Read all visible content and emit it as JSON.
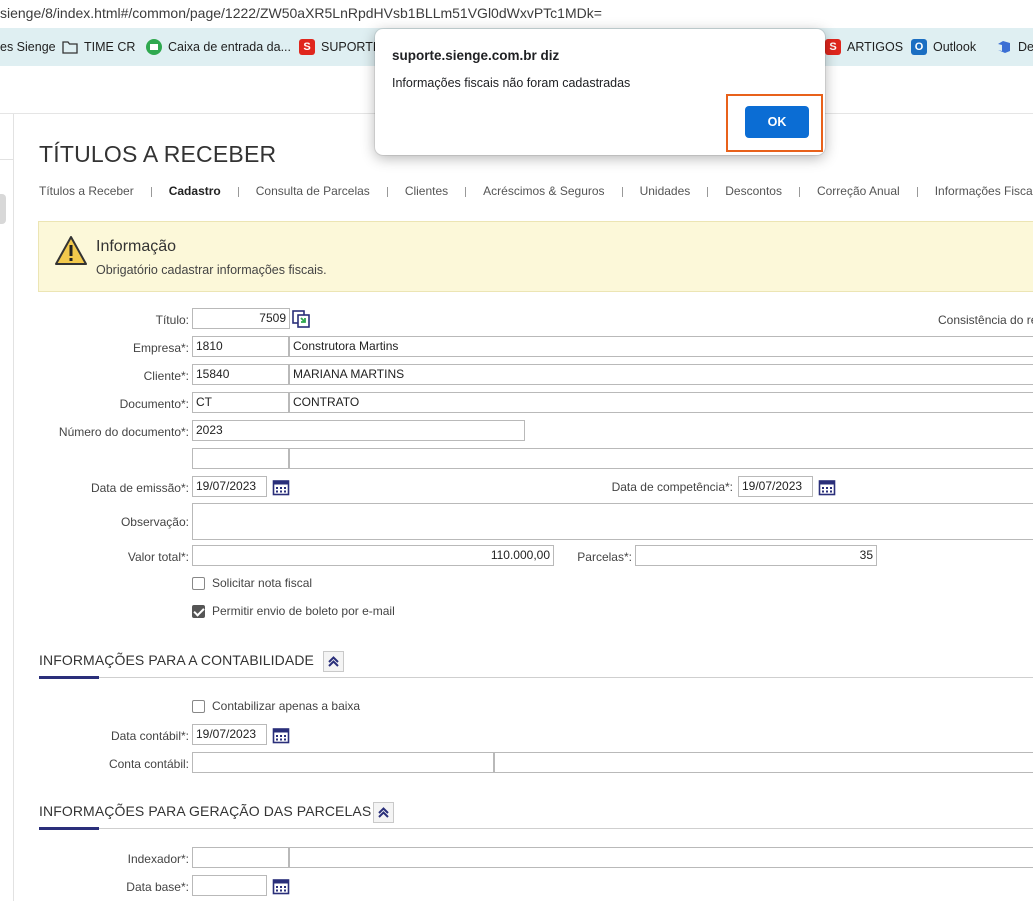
{
  "browser": {
    "url": "sienge/8/index.html#/common/page/1222/ZW50aXR5LnRpdHVsb1BLLm51VGl0dWxvPTc1MDk=",
    "bookmarks": [
      {
        "label": "es Sienge",
        "icon": "folder-icon"
      },
      {
        "label": "TIME CR",
        "icon": "folder-icon"
      },
      {
        "label": "Caixa de entrada da...",
        "icon": "mail-icon",
        "color": "#2fa84f"
      },
      {
        "label": "SUPORTE",
        "icon": "s-logo-icon",
        "color": "#e0261d"
      },
      {
        "label": "ARTIGOS",
        "icon": "s-logo-icon",
        "color": "#e0261d"
      },
      {
        "label": "Outlook",
        "icon": "outlook-icon",
        "color": "#1b6ec2"
      },
      {
        "label": "De",
        "icon": "azure-devops-icon",
        "color": "#3b6fd4"
      }
    ]
  },
  "page": {
    "title": "TÍTULOS A RECEBER",
    "tabs": [
      "Títulos a Receber",
      "Cadastro",
      "Consulta de Parcelas",
      "Clientes",
      "Acréscimos & Seguros",
      "Unidades",
      "Descontos",
      "Correção Anual",
      "Informações Fiscais"
    ],
    "active_tab": "Cadastro"
  },
  "info": {
    "title": "Informação",
    "message": "Obrigatório cadastrar informações fiscais."
  },
  "form": {
    "titulo_label": "Título:",
    "titulo_value": "7509",
    "consistencia_label": "Consistência do re",
    "empresa_label": "Empresa*:",
    "empresa_code": "1810",
    "empresa_name": "Construtora Martins",
    "cliente_label": "Cliente*:",
    "cliente_code": "15840",
    "cliente_name": "MARIANA MARTINS",
    "documento_label": "Documento*:",
    "documento_code": "CT",
    "documento_name": "CONTRATO",
    "numero_label": "Número do documento*:",
    "numero_value": "2023",
    "emissao_label": "Data de emissão*:",
    "emissao_value": "19/07/2023",
    "competencia_label": "Data de competência*:",
    "competencia_value": "19/07/2023",
    "observacao_label": "Observação:",
    "valor_label": "Valor total*:",
    "valor_value": "110.000,00",
    "parcelas_label": "Parcelas*:",
    "parcelas_value": "35",
    "nota_fiscal_label": "Solicitar nota fiscal",
    "nota_fiscal_checked": false,
    "boleto_label": "Permitir envio de boleto por e-mail",
    "boleto_checked": true
  },
  "contabilidade": {
    "title": "INFORMAÇÕES PARA A CONTABILIDADE",
    "baixa_label": "Contabilizar apenas a baixa",
    "baixa_checked": false,
    "data_label": "Data contábil*:",
    "data_value": "19/07/2023",
    "conta_label": "Conta contábil:"
  },
  "parcelas": {
    "title": "INFORMAÇÕES PARA GERAÇÃO DAS PARCELAS",
    "indexador_label": "Indexador*:",
    "data_base_label": "Data base*:"
  },
  "dialog": {
    "title": "suporte.sienge.com.br diz",
    "message": "Informações fiscais não foram cadastradas",
    "ok_label": "OK"
  },
  "colors": {
    "accent": "#2a2f7a",
    "ok_button": "#0b6dd4",
    "highlight": "#e8611b",
    "info_bg": "#fcf8d9",
    "bookmark_bar": "#dfeff2"
  }
}
